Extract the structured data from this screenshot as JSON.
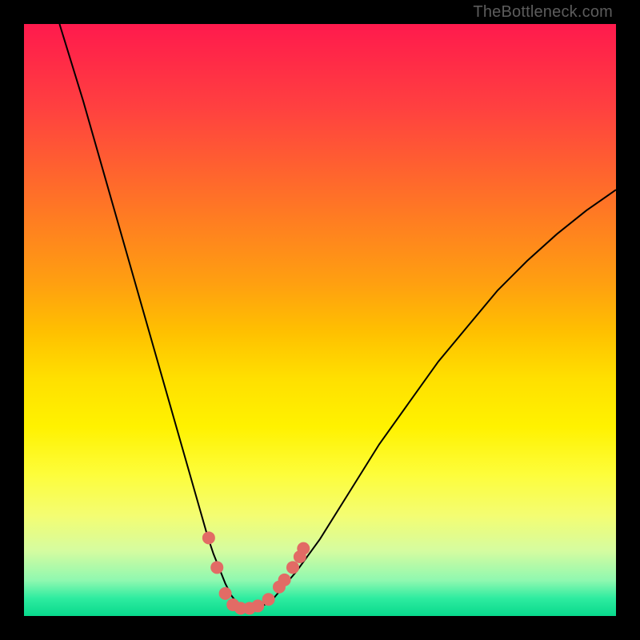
{
  "watermark": "TheBottleneck.com",
  "colors": {
    "frame": "#000000",
    "curve_stroke": "#000000",
    "marker_fill": "#e26b65",
    "marker_stroke": "#b34d47"
  },
  "chart_data": {
    "type": "line",
    "title": "",
    "xlabel": "",
    "ylabel": "",
    "xlim": [
      0,
      100
    ],
    "ylim": [
      0,
      100
    ],
    "grid": false,
    "legend": false,
    "series": [
      {
        "name": "bottleneck-curve",
        "x": [
          6,
          10,
          14,
          18,
          22,
          26,
          28,
          30,
          31,
          32,
          33,
          34,
          35,
          36,
          37,
          38,
          39,
          40,
          42,
          46,
          50,
          55,
          60,
          65,
          70,
          75,
          80,
          85,
          90,
          95,
          100
        ],
        "y": [
          100,
          87,
          73,
          59,
          45,
          31,
          24,
          17,
          13.5,
          10.5,
          8,
          5.5,
          3.5,
          2.2,
          1.5,
          1.2,
          1.2,
          1.5,
          2.8,
          7.5,
          13,
          21,
          29,
          36,
          43,
          49,
          55,
          60,
          64.5,
          68.5,
          72
        ]
      }
    ],
    "markers": [
      {
        "x": 31.2,
        "y": 13.2
      },
      {
        "x": 32.6,
        "y": 8.2
      },
      {
        "x": 34.0,
        "y": 3.8
      },
      {
        "x": 35.3,
        "y": 1.9
      },
      {
        "x": 36.6,
        "y": 1.3
      },
      {
        "x": 38.1,
        "y": 1.3
      },
      {
        "x": 39.5,
        "y": 1.7
      },
      {
        "x": 41.3,
        "y": 2.8
      },
      {
        "x": 43.1,
        "y": 4.9
      },
      {
        "x": 44.0,
        "y": 6.1
      },
      {
        "x": 45.4,
        "y": 8.2
      },
      {
        "x": 46.6,
        "y": 10.0
      },
      {
        "x": 47.2,
        "y": 11.4
      }
    ]
  }
}
